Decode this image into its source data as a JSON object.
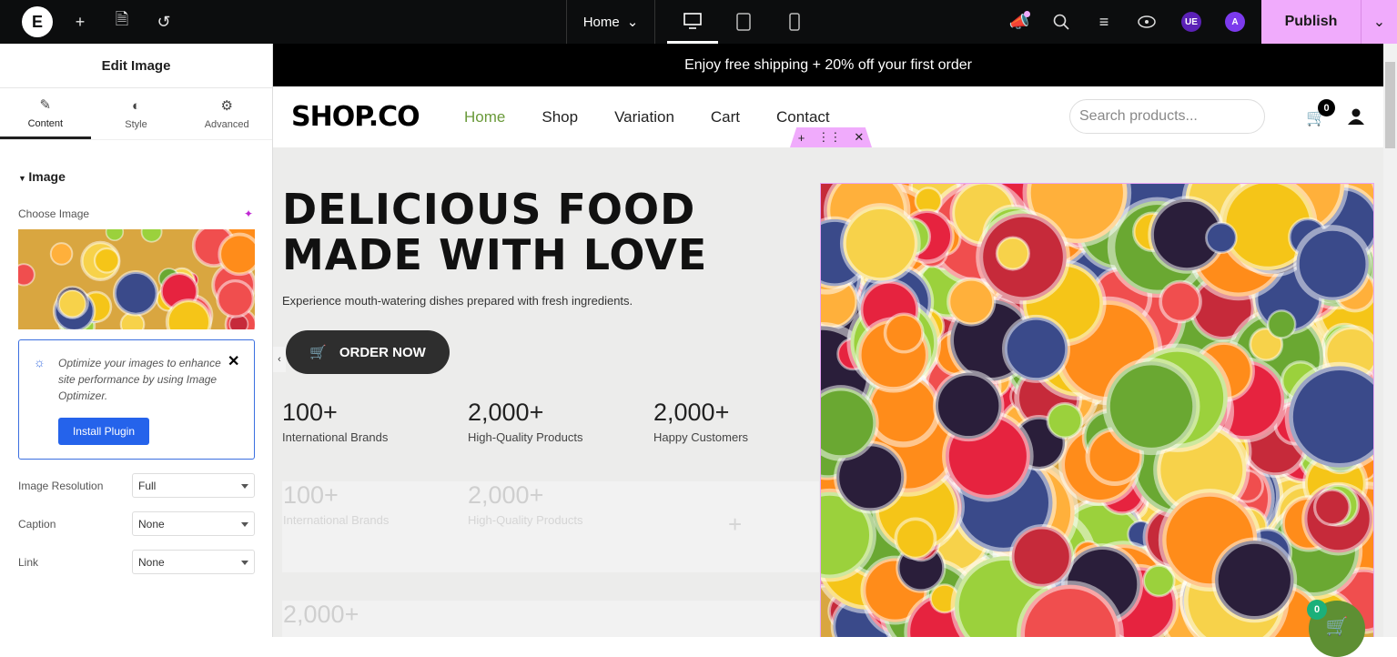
{
  "topbar": {
    "page": "Home",
    "publish": "Publish",
    "avatar1": "UE",
    "avatar2": "A"
  },
  "sidebar": {
    "title": "Edit Image",
    "tabs": [
      {
        "label": "Content"
      },
      {
        "label": "Style"
      },
      {
        "label": "Advanced"
      }
    ],
    "section": "Image",
    "choose_image": "Choose Image",
    "notice": {
      "text": "Optimize your images to enhance site performance by using Image Optimizer.",
      "button": "Install Plugin"
    },
    "fields": [
      {
        "label": "Image Resolution",
        "value": "Full"
      },
      {
        "label": "Caption",
        "value": "None"
      },
      {
        "label": "Link",
        "value": "None"
      }
    ]
  },
  "site": {
    "announcement": "Enjoy free shipping + 20% off your first order",
    "brand": "SHOP.CO",
    "nav": [
      "Home",
      "Shop",
      "Variation",
      "Cart",
      "Contact"
    ],
    "search_placeholder": "Search products...",
    "cart_count": "0",
    "hero": {
      "title_line1": "DELICIOUS FOOD",
      "title_line2": "MADE WITH LOVE",
      "subtitle": "Experience mouth-watering dishes prepared with fresh ingredients.",
      "cta": "ORDER NOW"
    },
    "stats": [
      {
        "n": "100+",
        "t": "International Brands"
      },
      {
        "n": "2,000+",
        "t": "High-Quality Products"
      },
      {
        "n": "2,000+",
        "t": "Happy Customers"
      }
    ],
    "ghost_stats": [
      {
        "n": "100+",
        "t": "International Brands"
      },
      {
        "n": "2,000+",
        "t": "High-Quality Products"
      },
      {
        "n": "2,000+"
      }
    ],
    "floating_cart_count": "0"
  },
  "colors": {
    "accent": "#f0abfc",
    "nav_active": "#6a9a3a",
    "install": "#2563eb",
    "float_cart": "#5e8f33"
  }
}
